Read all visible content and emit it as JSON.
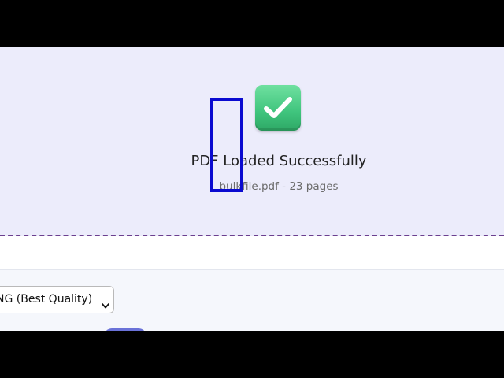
{
  "status": {
    "title": "PDF Loaded Successfully",
    "file_info": "bulkfile.pdf - 23 pages",
    "icon": "check-mark-button-icon"
  },
  "options": {
    "format_select_value": "NG (Best Quality)",
    "chevron_icon": "chevron-down-icon"
  },
  "colors": {
    "upload_zone_bg": "#ececfb",
    "dashed_border": "#6b3f8f",
    "success_green": "#3fc47d",
    "focus_highlight": "#0a0ad0",
    "button_accent": "#6a72d8"
  }
}
